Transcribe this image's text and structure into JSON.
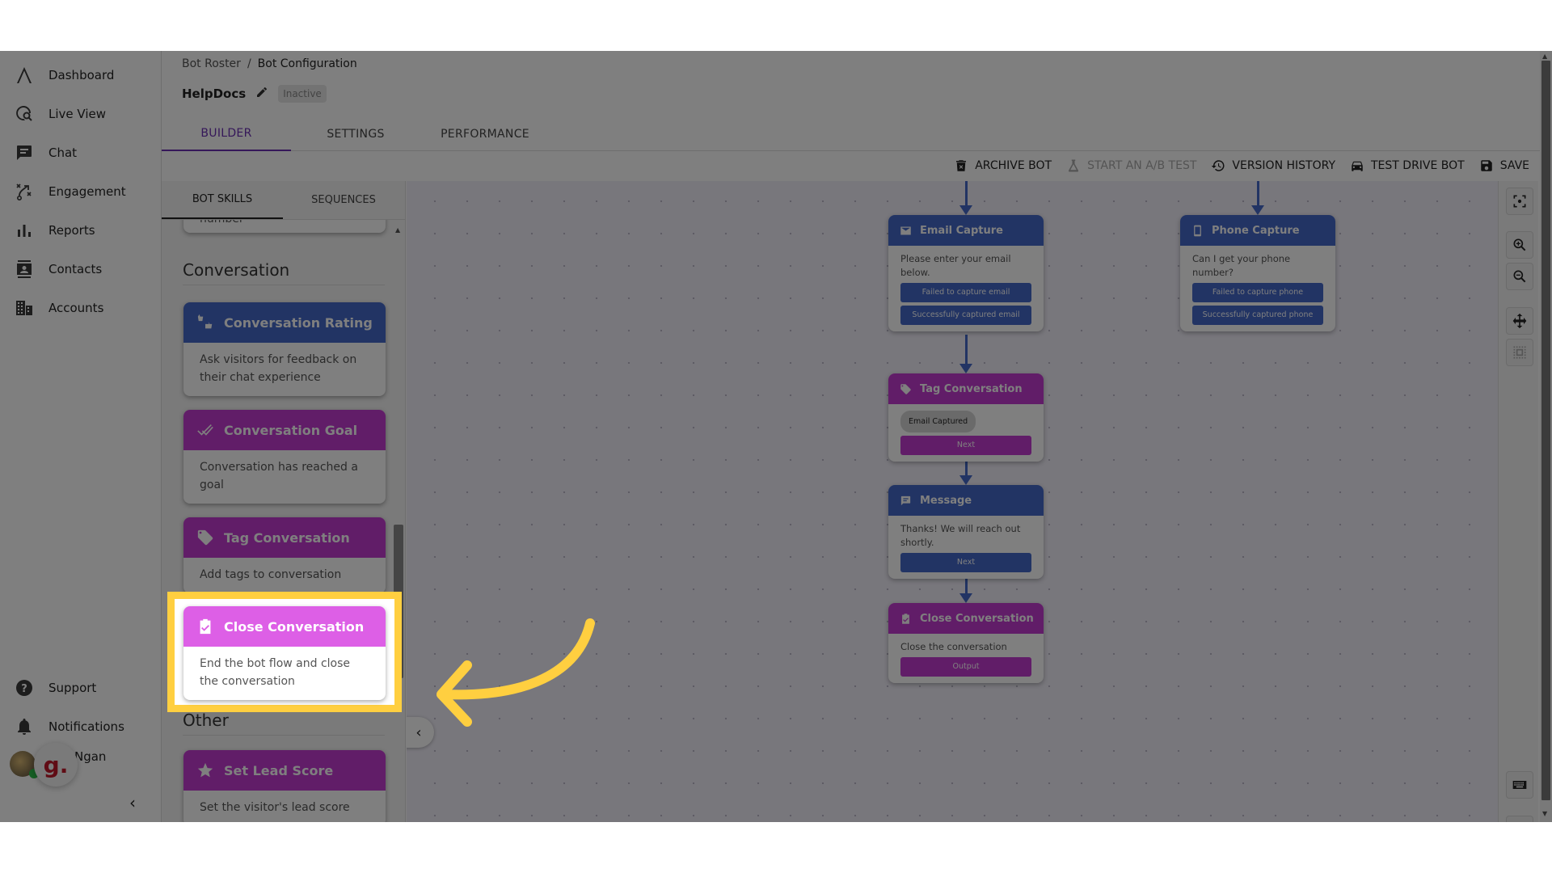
{
  "sidebar": {
    "items": [
      {
        "label": "Dashboard",
        "icon": "logo-icon"
      },
      {
        "label": "Live View",
        "icon": "live-view-icon"
      },
      {
        "label": "Chat",
        "icon": "chat-icon"
      },
      {
        "label": "Engagement",
        "icon": "engagement-icon"
      },
      {
        "label": "Reports",
        "icon": "reports-icon"
      },
      {
        "label": "Contacts",
        "icon": "contacts-icon"
      },
      {
        "label": "Accounts",
        "icon": "accounts-icon"
      }
    ],
    "bottom_items": [
      {
        "label": "Support",
        "icon": "help-icon"
      },
      {
        "label": "Notifications",
        "icon": "bell-icon"
      }
    ],
    "user_name": "Ngan",
    "overlay_logo_text": "g.",
    "collapse_glyph": "‹"
  },
  "header": {
    "breadcrumb": [
      "Bot Roster",
      "/",
      "Bot Configuration"
    ],
    "bot_name": "HelpDocs",
    "status": "Inactive",
    "tabs": [
      {
        "label": "BUILDER",
        "active": true
      },
      {
        "label": "SETTINGS",
        "active": false
      },
      {
        "label": "PERFORMANCE",
        "active": false
      }
    ]
  },
  "toolbar": {
    "archive": "ARCHIVE BOT",
    "ab_test": "START AN A/B TEST",
    "version_history": "VERSION HISTORY",
    "test_drive": "TEST DRIVE BOT",
    "save": "SAVE"
  },
  "skills_panel": {
    "tabs": [
      {
        "label": "BOT SKILLS",
        "active": true
      },
      {
        "label": "SEQUENCES",
        "active": false
      }
    ],
    "partial_card_text": "number",
    "sections": [
      {
        "title": "Conversation",
        "skills": [
          {
            "title": "Conversation Rating",
            "description": "Ask visitors for feedback on their chat experience",
            "color": "#4569c9"
          },
          {
            "title": "Conversation Goal",
            "description": "Conversation has reached a goal",
            "color": "#c33ad0"
          },
          {
            "title": "Tag Conversation",
            "description": "Add tags to conversation",
            "color": "#c33ad0"
          },
          {
            "title": "Close Conversation",
            "description": "End the bot flow and close the conversation",
            "color": "#dd5fe6",
            "highlighted": true
          }
        ]
      },
      {
        "title": "Other",
        "skills": [
          {
            "title": "Set Lead Score",
            "description": "Set the visitor's lead score",
            "color": "#c33ad0"
          }
        ]
      }
    ]
  },
  "canvas": {
    "nodes": {
      "email_capture": {
        "title": "Email Capture",
        "text": "Please enter your email below.",
        "buttons": [
          "Failed to capture email",
          "Successfully captured email"
        ]
      },
      "phone_capture": {
        "title": "Phone Capture",
        "text": "Can I get your phone number?",
        "buttons": [
          "Failed to capture phone",
          "Successfully captured phone"
        ]
      },
      "tag_conversation": {
        "title": "Tag Conversation",
        "chip": "Email Captured",
        "buttons": [
          "Next"
        ]
      },
      "message": {
        "title": "Message",
        "text": "Thanks! We will reach out shortly.",
        "buttons": [
          "Next"
        ]
      },
      "close_conversation": {
        "title": "Close Conversation",
        "text": "Close the conversation",
        "buttons": [
          "Output"
        ]
      }
    },
    "collapse_glyph": "‹"
  },
  "controls": [
    "center-focus",
    "zoom-in",
    "zoom-out",
    "pan",
    "fit-selection",
    "keyboard",
    "fullscreen"
  ],
  "annotation": {
    "highlight_color": "#ffcf40",
    "arrow_color": "#ffcf40"
  },
  "colors": {
    "brand_purple": "#6b2fb3",
    "node_blue": "#4569c9",
    "node_purple": "#c33ad0"
  }
}
